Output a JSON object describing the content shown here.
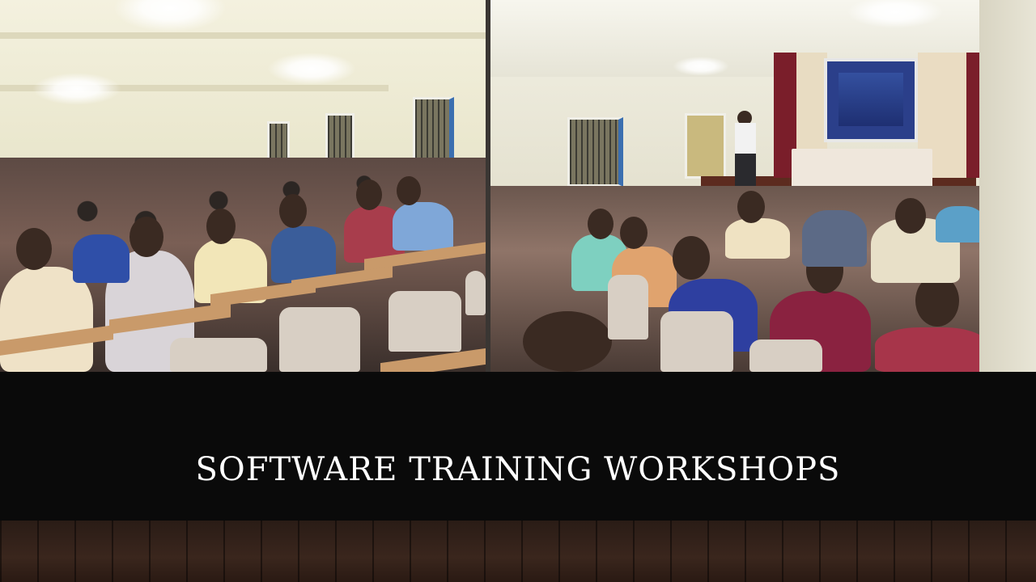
{
  "slide": {
    "caption": "SOFTWARE TRAINING WORKSHOPS",
    "images": [
      {
        "name": "lecture-hall-students-photo",
        "icon": "photo-icon"
      },
      {
        "name": "workshop-presentation-photo",
        "icon": "photo-icon"
      }
    ]
  },
  "colors": {
    "caption_band": "#0a0a0a",
    "caption_text": "#ffffff",
    "floor": "#3a261d"
  }
}
